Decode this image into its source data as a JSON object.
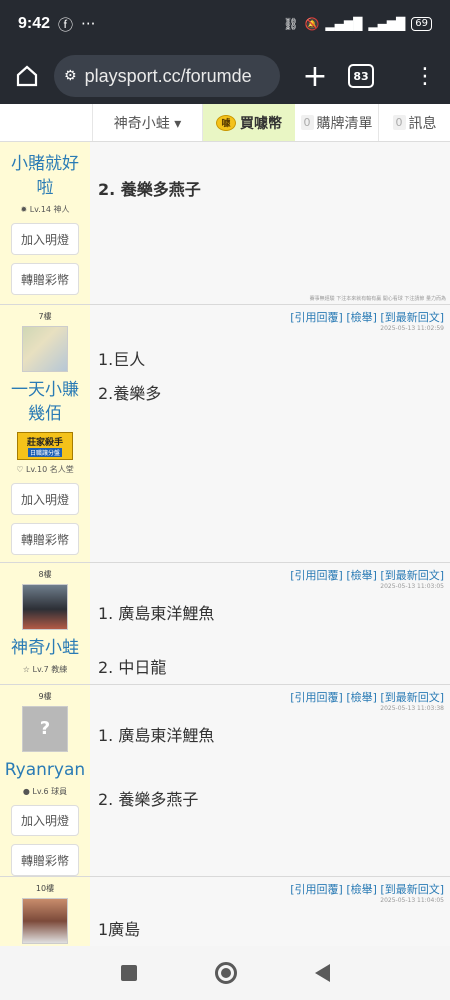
{
  "status": {
    "time": "9:42",
    "battery": "69"
  },
  "browser": {
    "url": "playsport.cc/forumde",
    "tab_count": "83"
  },
  "nav": {
    "user": "神奇小蛙 ▾",
    "buy": "買噱幣",
    "cart_count": "0",
    "cart": "購牌清單",
    "msg_count": "0",
    "msg": "訊息"
  },
  "actions": {
    "quote": "[引用回覆]",
    "report": "[檢舉]",
    "latest": "[到最新回文]",
    "add_light": "加入明燈",
    "gift": "轉贈彩幣"
  },
  "footnote": "賽事無經驗 下注本來就有輸有贏 開心看球 下注請節 量力而為",
  "posts": [
    {
      "floor": "",
      "name": "小賭就好啦",
      "level": "Lv.14 神人",
      "time": "",
      "lines": [
        "2. 養樂多燕子"
      ]
    },
    {
      "floor": "7樓",
      "name": "一天小賺幾佰",
      "level": "Lv.10 名人堂",
      "badge": "莊家殺手",
      "badge_sub": "日職讓分盤",
      "time": "2025-05-13 11:02:59",
      "lines": [
        "1.巨人",
        "2.養樂多"
      ]
    },
    {
      "floor": "8樓",
      "name": "神奇小蛙",
      "level": "Lv.7 教練",
      "time": "2025-05-13 11:03:05",
      "lines": [
        "1. 廣島東洋鯉魚",
        "2. 中日龍"
      ]
    },
    {
      "floor": "9樓",
      "name": "Ryanryan",
      "level": "Lv.6 球員",
      "time": "2025-05-13 11:03:38",
      "lines": [
        "1. 廣島東洋鯉魚",
        "2. 養樂多燕子"
      ]
    },
    {
      "floor": "10樓",
      "name": "",
      "level": "",
      "time": "2025-05-13 11:04:05",
      "lines": [
        "1廣島"
      ]
    }
  ]
}
